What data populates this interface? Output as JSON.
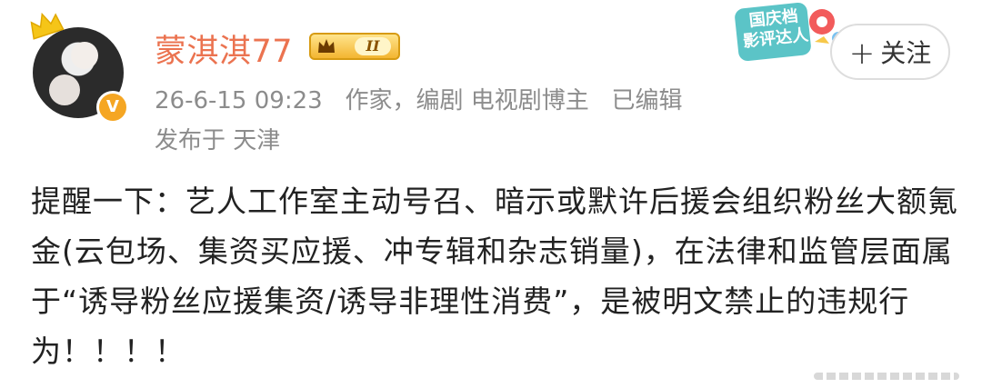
{
  "author": {
    "name": "蒙淇淇77",
    "level_badge": "II",
    "verified_badge": "V",
    "avatar_icon": "profile-photo",
    "crown_icon": "crown-icon"
  },
  "post_meta": {
    "timestamp": "26-6-15 09:23",
    "description": "作家，编剧 电视剧博主",
    "edited": "已编辑",
    "location": "发布于 天津"
  },
  "medal": {
    "line1": "国庆档",
    "line2": "影评达人"
  },
  "follow_button": {
    "label": "关注",
    "icon": "plus-icon"
  },
  "post_text": "提醒一下：艺人工作室主动号召、暗示或默许后援会组织粉丝大额氪金(云包场、集资买应援、冲专辑和杂志销量)，在法律和监管层面属于“诱导粉丝应援集资/诱导非理性消费”，是被明文禁止的违规行为！！！！",
  "colors": {
    "username": "#eb7350",
    "meta": "#8c8c8c",
    "badge_gold": "#f3b531"
  }
}
